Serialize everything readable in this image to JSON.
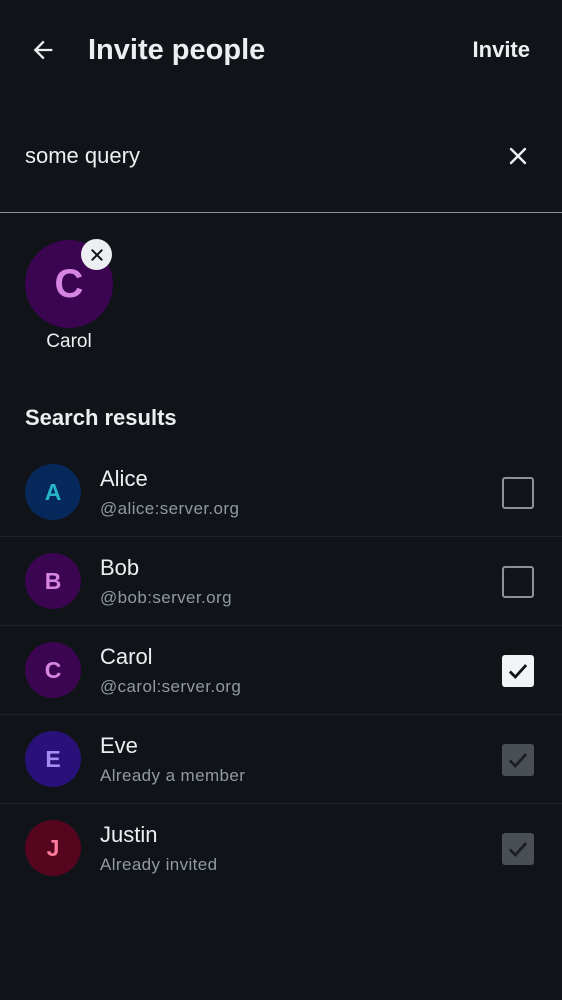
{
  "header": {
    "title": "Invite people",
    "invite_action": "Invite",
    "back_icon": "arrow-left-icon"
  },
  "search": {
    "value": "some query",
    "clear_icon": "close-icon"
  },
  "selected_users": [
    {
      "initial": "C",
      "name": "Carol",
      "avatar_bg": "#3b0552",
      "avatar_fg": "#d685e3"
    }
  ],
  "results": {
    "title": "Search results",
    "items": [
      {
        "initial": "A",
        "name": "Alice",
        "subtitle": "@alice:server.org",
        "state": "unchecked",
        "avatar_bg": "#06285b",
        "avatar_fg": "#27b4c9"
      },
      {
        "initial": "B",
        "name": "Bob",
        "subtitle": "@bob:server.org",
        "state": "unchecked",
        "avatar_bg": "#3b0552",
        "avatar_fg": "#d685e3"
      },
      {
        "initial": "C",
        "name": "Carol",
        "subtitle": "@carol:server.org",
        "state": "checked",
        "avatar_bg": "#3b0552",
        "avatar_fg": "#d685e3"
      },
      {
        "initial": "E",
        "name": "Eve",
        "subtitle": "Already a member",
        "state": "disabled-checked",
        "avatar_bg": "#2a117a",
        "avatar_fg": "#a58bf2"
      },
      {
        "initial": "J",
        "name": "Justin",
        "subtitle": "Already invited",
        "state": "disabled-checked",
        "avatar_bg": "#56051f",
        "avatar_fg": "#ff7b9c"
      }
    ]
  },
  "colors": {
    "background": "#101419",
    "text_primary": "#eceef1",
    "text_secondary": "#9199a3"
  }
}
